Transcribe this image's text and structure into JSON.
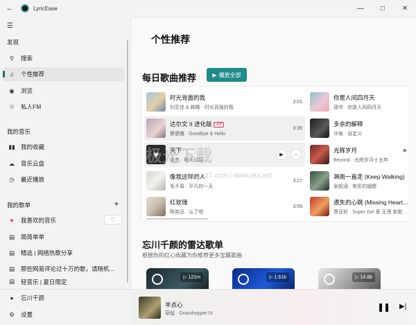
{
  "app": {
    "title": "LyricEase"
  },
  "sidebar": {
    "section_discover": "发现",
    "discover_items": [
      {
        "icon": "search-icon",
        "label": "搜索"
      },
      {
        "icon": "headphone-icon",
        "label": "个性推荐"
      },
      {
        "icon": "globe-icon",
        "label": "浏览"
      },
      {
        "icon": "radio-icon",
        "label": "私人FM"
      }
    ],
    "section_music": "我的音乐",
    "music_items": [
      {
        "icon": "library-icon",
        "label": "我的收藏"
      },
      {
        "icon": "cloud-icon",
        "label": "音乐云盘"
      },
      {
        "icon": "clock-icon",
        "label": "最近播放"
      }
    ],
    "section_playlists": "我的歌单",
    "playlist_items": [
      {
        "icon": "heart-icon",
        "label": "我喜欢的音乐"
      },
      {
        "icon": "playlist-icon",
        "label": "简简单单"
      },
      {
        "icon": "playlist-icon",
        "label": "精选 | 网络热歌分享"
      },
      {
        "icon": "playlist-icon",
        "label": "那些网易评论过十万的歌，请随机播放。"
      },
      {
        "icon": "playlist-icon",
        "label": "轻音乐 | 夏日限定"
      }
    ],
    "user_name": "忘川千颜",
    "settings_label": "设置"
  },
  "main": {
    "page_title": "个性推荐",
    "daily_title": "每日歌曲推荐",
    "play_all": "播放全部",
    "daily_left": [
      {
        "name": "时光背面的我",
        "artist": "刘至佳 & 韩瞳 · 时光背面的我",
        "duration": "3:01",
        "vip": ""
      },
      {
        "name": "达尔文 II 进化版",
        "artist": "蔡健雅 · Goodbye & Hello",
        "duration": "3:39",
        "vip": "VIP"
      },
      {
        "name": "天下",
        "artist": "张杰 · 明天过后",
        "duration": "",
        "vip": ""
      },
      {
        "name": "像我这样的人",
        "artist": "毛不易 · 平凡的一天",
        "duration": "3:27",
        "vip": ""
      },
      {
        "name": "红玫瑰",
        "artist": "陈奕迅 · 认了吧",
        "duration": "3:59",
        "vip": ""
      }
    ],
    "daily_right": [
      {
        "name": "你是人间四月天",
        "artist": "邵帅 · 你是人间四月天"
      },
      {
        "name": "多余的解释",
        "artist": "许嵩 · 自定义"
      },
      {
        "name": "光辉岁月",
        "artist": "Beyond · 光辉岁月十五年"
      },
      {
        "name": "淋雨一直走 (Keep Walking)",
        "artist": "张韶涵 · 有形的翅膀"
      },
      {
        "name": "遗失的心跳 (Missing Heartbeat)",
        "artist": "萧亚轩 · Super Girl 爱 无畏 新歌 + 精选"
      }
    ],
    "radar_title": "忘川千颜的雷达歌单",
    "radar_subtitle": "根据你的红心收藏为你推荐更多宝藏歌曲",
    "radar_cards": [
      {
        "plays": "121m"
      },
      {
        "plays": "1.61b"
      },
      {
        "plays": "14.8b"
      }
    ]
  },
  "player": {
    "song": "半点心",
    "artist": "草蜢 · Grasshopper IV"
  },
  "watermark": {
    "main": "极光下载",
    "sub": "www.xz7.com / www.xkx.net"
  }
}
